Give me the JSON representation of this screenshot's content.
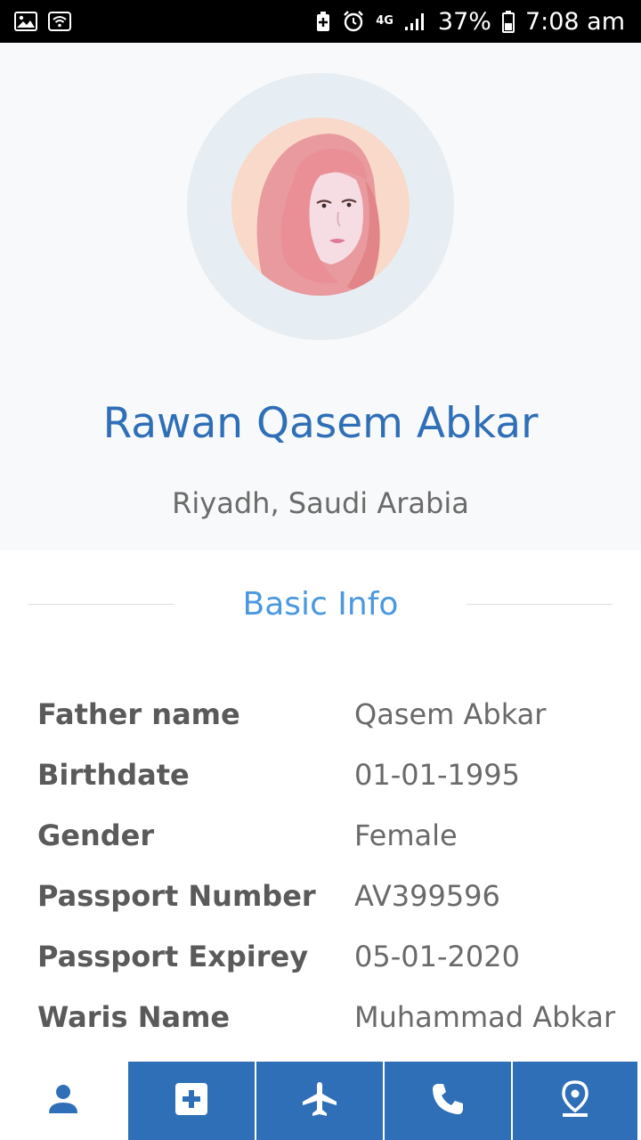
{
  "status_bar": {
    "network": "4G",
    "battery": "37%",
    "time": "7:08 am"
  },
  "profile": {
    "name": "Rawan Qasem Abkar",
    "location": "Riyadh, Saudi Arabia"
  },
  "section": {
    "title": "Basic Info"
  },
  "info": [
    {
      "label": "Father name",
      "value": "Qasem Abkar"
    },
    {
      "label": "Birthdate",
      "value": "01-01-1995"
    },
    {
      "label": "Gender",
      "value": "Female"
    },
    {
      "label": "Passport Number",
      "value": "AV399596"
    },
    {
      "label": "Passport Expirey",
      "value": "05-01-2020"
    },
    {
      "label": "Waris Name",
      "value": "Muhammad Abkar"
    }
  ],
  "nav": {
    "items": [
      {
        "icon": "person-icon",
        "active": true
      },
      {
        "icon": "medical-plus-icon",
        "active": false
      },
      {
        "icon": "airplane-icon",
        "active": false
      },
      {
        "icon": "phone-icon",
        "active": false
      },
      {
        "icon": "location-pin-icon",
        "active": false
      }
    ]
  },
  "colors": {
    "accent": "#2f6fb7",
    "section_title": "#4a98e0",
    "header_bg": "#f8f9fa",
    "avatar_ring": "#e6eef4"
  }
}
